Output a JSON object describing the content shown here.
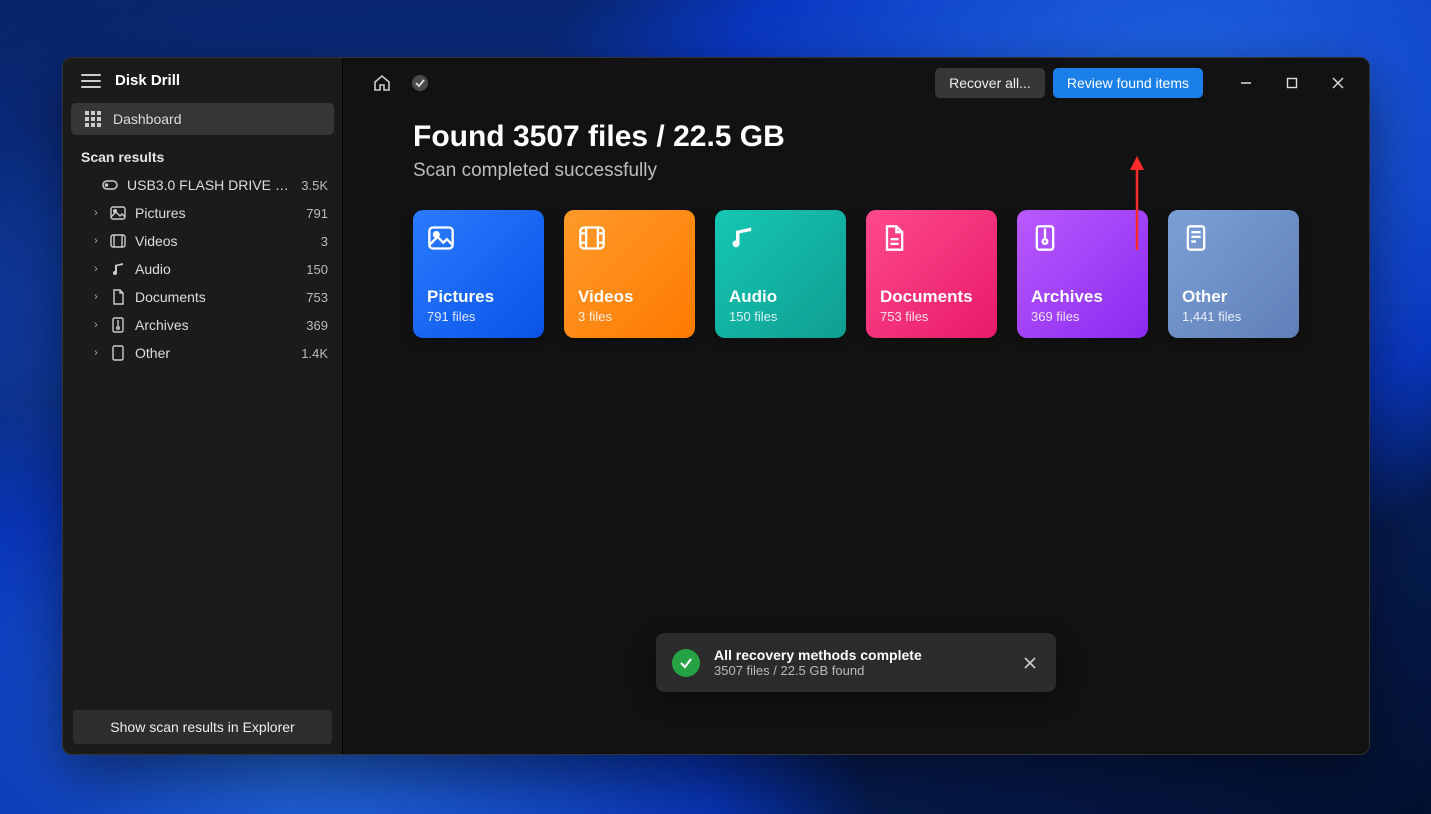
{
  "app": {
    "title": "Disk Drill"
  },
  "sidebar": {
    "dashboard_label": "Dashboard",
    "section_label": "Scan results",
    "device": {
      "label": "USB3.0 FLASH DRIVE US...",
      "count": "3.5K"
    },
    "tree": {
      "pictures": {
        "label": "Pictures",
        "count": "791"
      },
      "videos": {
        "label": "Videos",
        "count": "3"
      },
      "audio": {
        "label": "Audio",
        "count": "150"
      },
      "documents": {
        "label": "Documents",
        "count": "753"
      },
      "archives": {
        "label": "Archives",
        "count": "369"
      },
      "other": {
        "label": "Other",
        "count": "1.4K"
      }
    },
    "footer_button": "Show scan results in Explorer"
  },
  "topbar": {
    "recover_label": "Recover all...",
    "review_label": "Review found items"
  },
  "main": {
    "headline": "Found 3507 files / 22.5 GB",
    "subhead": "Scan completed successfully"
  },
  "cards": {
    "pictures": {
      "title": "Pictures",
      "sub": "791 files"
    },
    "videos": {
      "title": "Videos",
      "sub": "3 files"
    },
    "audio": {
      "title": "Audio",
      "sub": "150 files"
    },
    "documents": {
      "title": "Documents",
      "sub": "753 files"
    },
    "archives": {
      "title": "Archives",
      "sub": "369 files"
    },
    "other": {
      "title": "Other",
      "sub": "1,441 files"
    }
  },
  "toast": {
    "title": "All recovery methods complete",
    "subtitle": "3507 files / 22.5 GB found"
  }
}
